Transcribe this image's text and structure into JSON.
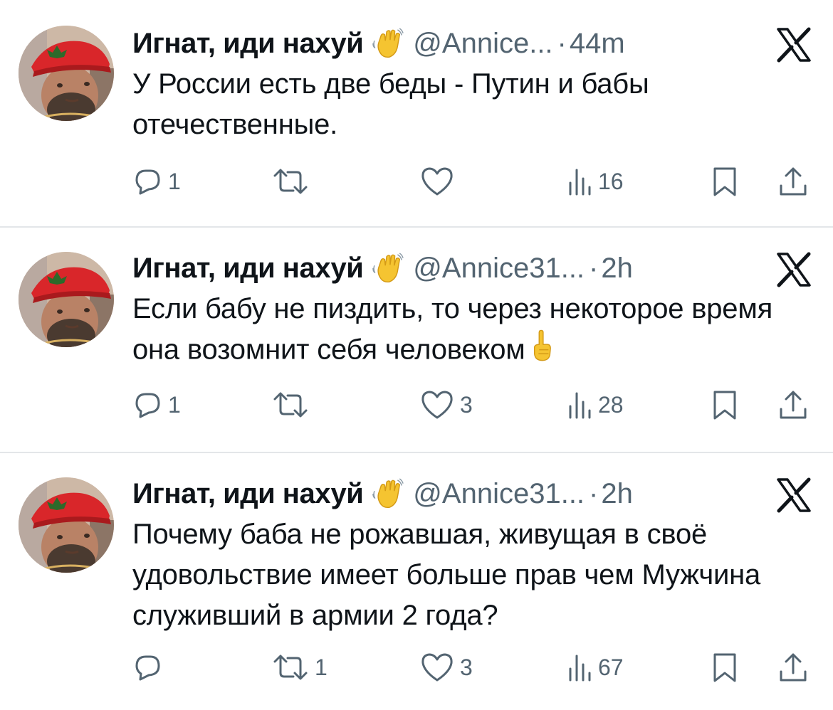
{
  "tweets": [
    {
      "name": "Игнат, иди нахуй",
      "handle": "@Annice...",
      "separator": "·",
      "time": "44m",
      "text": "У России есть две беды - Путин и бабы отечественные.",
      "text_emoji": "",
      "replies": "1",
      "retweets": "",
      "likes": "",
      "views": "16"
    },
    {
      "name": "Игнат, иди нахуй",
      "handle": "@Annice31...",
      "separator": "·",
      "time": "2h",
      "text": "Если бабу не пиздить, то через некоторое время она возомнит себя человеком",
      "text_emoji": "pointing-up-emoji",
      "replies": "1",
      "retweets": "",
      "likes": "3",
      "views": "28"
    },
    {
      "name": "Игнат, иди нахуй",
      "handle": "@Annice31...",
      "separator": "·",
      "time": "2h",
      "text": "Почему баба не рожавшая, живущая в своё удовольствие имеет больше прав чем Мужчина служивший в армии 2 года?",
      "text_emoji": "",
      "replies": "",
      "retweets": "1",
      "likes": "3",
      "views": "67"
    }
  ],
  "icons": {
    "name_badge": "waving-hand-emoji",
    "platform": "x-logo",
    "reply": "reply-icon",
    "retweet": "retweet-icon",
    "like": "heart-icon",
    "views": "views-icon",
    "bookmark": "bookmark-icon",
    "share": "share-icon"
  },
  "colors": {
    "text": "#0f1419",
    "secondary": "#536471",
    "divider": "#e3e6e9",
    "emoji": "#f5c431"
  }
}
